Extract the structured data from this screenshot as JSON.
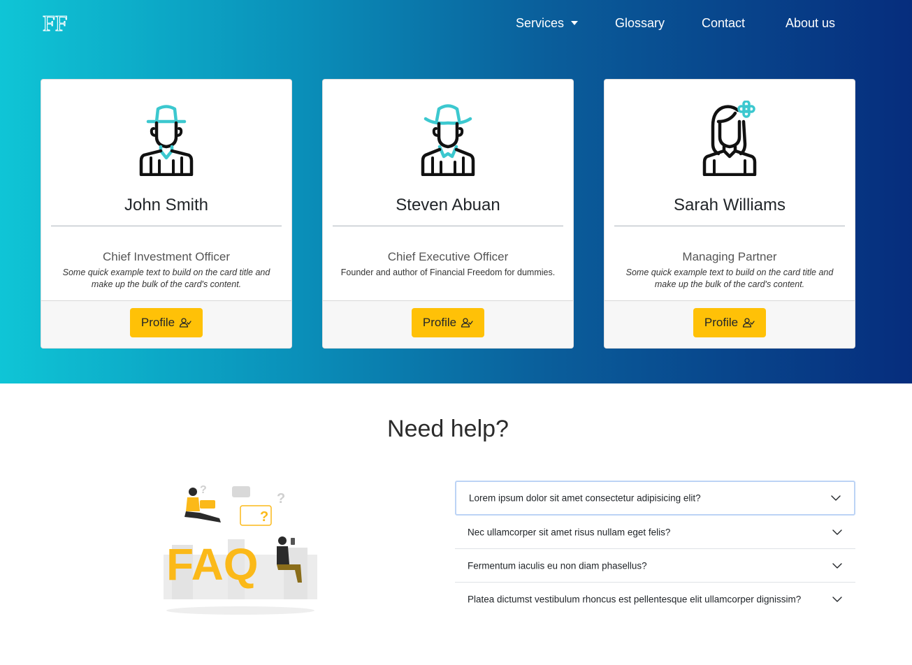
{
  "nav": {
    "logo_text": "FF",
    "items": [
      {
        "label": "Services",
        "has_caret": true
      },
      {
        "label": "Glossary"
      },
      {
        "label": "Contact"
      },
      {
        "label": "About us"
      }
    ]
  },
  "cards": [
    {
      "name": "John Smith",
      "role": "Chief Investment Officer",
      "text": "Some quick example text to build on the card title and make up the bulk of the card's content.",
      "button_label": "Profile",
      "avatar_icon": "man-hat-avatar-icon"
    },
    {
      "name": "Steven Abuan",
      "role": "Chief Executive Officer",
      "text": "Founder and author of Financial Freedom for dummies.",
      "button_label": "Profile",
      "avatar_icon": "cowboy-avatar-icon"
    },
    {
      "name": "Sarah Williams",
      "role": "Managing Partner",
      "text": "Some quick example text to build on the card title and make up the bulk of the card's content.",
      "button_label": "Profile",
      "avatar_icon": "woman-flower-avatar-icon"
    }
  ],
  "help": {
    "title": "Need help?",
    "illustration_text": "FAQ"
  },
  "faq": [
    {
      "question": "Lorem ipsum dolor sit amet consectetur adipisicing elit?",
      "focused": true
    },
    {
      "question": "Nec ullamcorper sit amet risus nullam eget felis?"
    },
    {
      "question": "Fermentum iaculis eu non diam phasellus?"
    },
    {
      "question": "Platea dictumst vestibulum rhoncus est pellentesque elit ullamcorper dignissim?"
    }
  ],
  "colors": {
    "hero_gradient_start": "#0fc5d6",
    "hero_gradient_end": "#062d7d",
    "button": "#ffc107",
    "accent_teal": "#3cc8cf"
  }
}
